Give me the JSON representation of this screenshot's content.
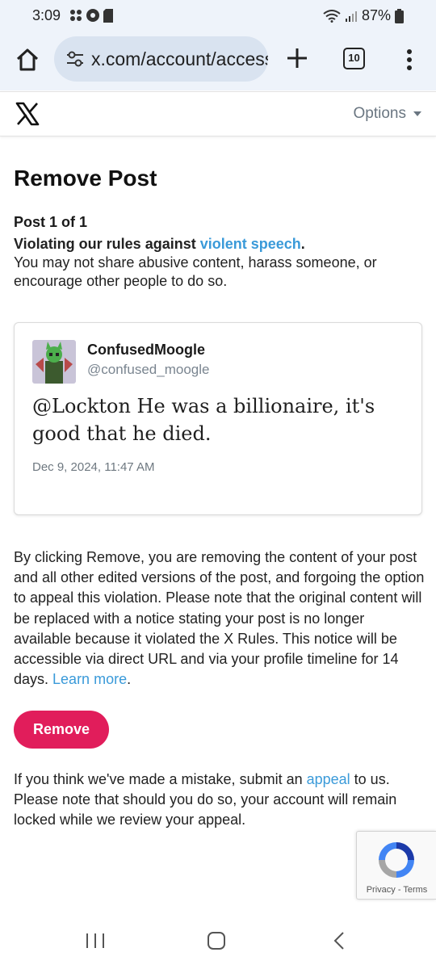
{
  "status_bar": {
    "time": "3:09",
    "battery": "87%"
  },
  "browser": {
    "url": "x.com/account/access",
    "tab_count": "10"
  },
  "header": {
    "options_label": "Options"
  },
  "page": {
    "title": "Remove Post",
    "post_count": "Post 1 of 1",
    "violation_prefix": "Violating our rules against ",
    "violation_link": "violent speech",
    "violation_suffix": ".",
    "violation_desc": "You may not share abusive content, harass someone, or encourage other people to do so."
  },
  "post": {
    "author_name": "ConfusedMoogle",
    "author_handle": "@confused_moogle",
    "text": "@Lockton He was a billionaire, it's good that he died.",
    "date": "Dec 9, 2024, 11:47 AM"
  },
  "explanation": {
    "text": "By clicking Remove, you are removing the content of your post and all other edited versions of the post, and forgoing the option to appeal this violation. Please note that the original content will be replaced with a notice stating your post is no longer available because it violated the X Rules. This notice will be accessible via direct URL and via your profile timeline for 14 days. ",
    "learn_more": "Learn more",
    "end": "."
  },
  "remove_button": "Remove",
  "appeal": {
    "prefix": "If you think we've made a mistake, submit an ",
    "link": "appeal",
    "suffix": " to us. Please note that should you do so, your account will remain locked while we review your appeal."
  },
  "recaptcha": {
    "privacy": "Privacy",
    "separator": " - ",
    "terms": "Terms"
  },
  "colors": {
    "accent_link": "#3a9ad9",
    "remove_button": "#e11d5b",
    "browser_bar": "#eef3fa"
  },
  "icons": {
    "home": "home-icon",
    "site_settings": "tune-icon",
    "new_tab": "plus-icon",
    "tabs": "tabs-counter-icon",
    "menu": "more-vertical-icon",
    "logo": "x-logo-icon",
    "options_caret": "caret-down-icon",
    "nav_recents": "recents-icon",
    "nav_home": "nav-home-icon",
    "nav_back": "back-icon"
  }
}
